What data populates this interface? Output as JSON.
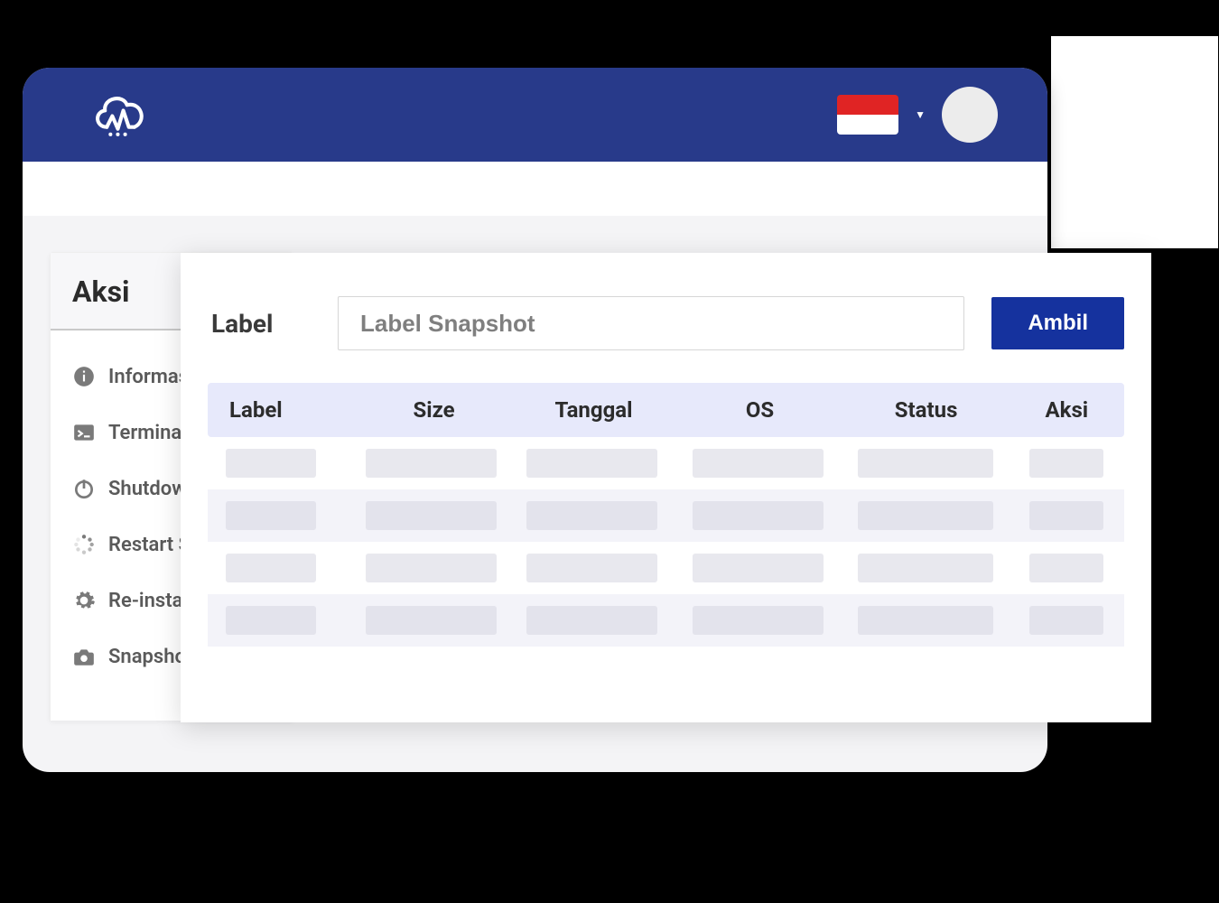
{
  "header": {
    "language": "Indonesia"
  },
  "sidebar": {
    "title": "Aksi",
    "items": [
      {
        "label": "Informasi",
        "icon": "info-icon"
      },
      {
        "label": "Terminal",
        "icon": "terminal-icon"
      },
      {
        "label": "Shutdown",
        "icon": "power-icon"
      },
      {
        "label": "Restart Server",
        "icon": "loading-icon"
      },
      {
        "label": "Re-install",
        "icon": "gear-icon"
      },
      {
        "label": "Snapshot",
        "icon": "camera-icon"
      }
    ]
  },
  "panel": {
    "form_label": "Label",
    "input_placeholder": "Label Snapshot",
    "input_value": "",
    "submit_label": "Ambil",
    "columns": {
      "label": "Label",
      "size": "Size",
      "date": "Tanggal",
      "os": "OS",
      "status": "Status",
      "aksi": "Aksi"
    },
    "row_count": 4
  }
}
